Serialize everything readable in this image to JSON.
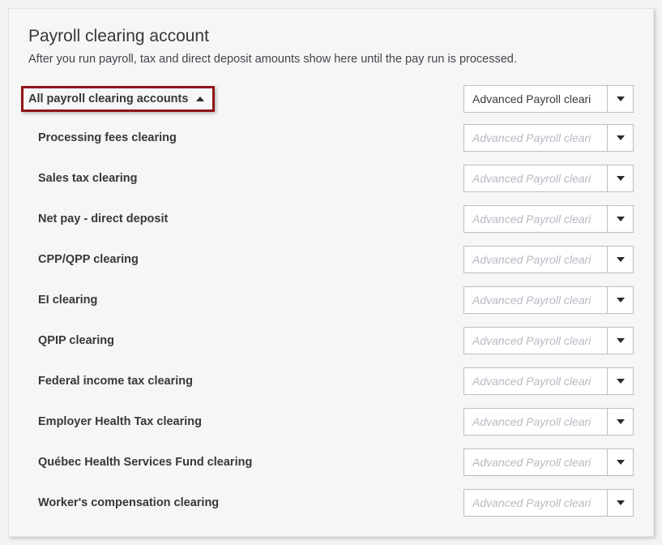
{
  "panel": {
    "title": "Payroll clearing account",
    "description": "After you run payroll, tax and direct deposit amounts show here until the pay run is processed."
  },
  "toggle": {
    "label": "All payroll clearing accounts"
  },
  "mainDropdown": {
    "value": "Advanced Payroll cleari"
  },
  "placeholderValue": "Advanced Payroll cleari",
  "rows": [
    {
      "label": "Processing fees clearing"
    },
    {
      "label": "Sales tax clearing"
    },
    {
      "label": "Net pay - direct deposit"
    },
    {
      "label": "CPP/QPP clearing"
    },
    {
      "label": "EI clearing"
    },
    {
      "label": "QPIP clearing"
    },
    {
      "label": "Federal income tax clearing"
    },
    {
      "label": "Employer Health Tax clearing"
    },
    {
      "label": "Québec Health Services Fund clearing"
    },
    {
      "label": "Worker's compensation clearing"
    }
  ]
}
